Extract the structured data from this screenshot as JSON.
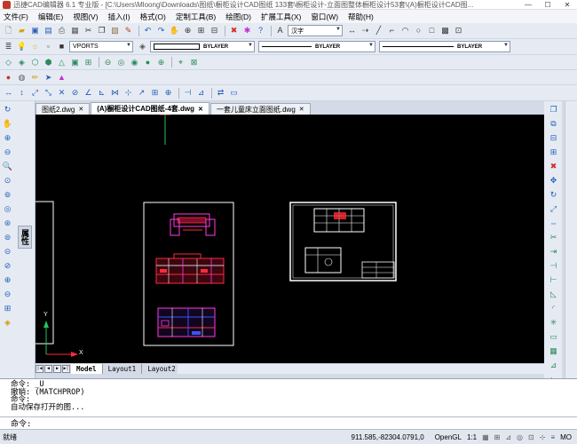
{
  "window": {
    "title": "迅捷CAD编辑器 6.1 专业版 - [C:\\Users\\Mloong\\Downloads\\图纸\\橱柜设计CAD图纸 133套\\橱柜设计-立面图整体橱柜设计53套\\(A)橱柜设计CAD图...",
    "minimize": "—",
    "maximize": "☐",
    "close": "✕"
  },
  "menu": [
    "文件(F)",
    "编辑(E)",
    "视图(V)",
    "插入(I)",
    "格式(O)",
    "定制工具(B)",
    "绘图(D)",
    "扩展工具(X)",
    "窗口(W)",
    "帮助(H)"
  ],
  "toolbars": {
    "font_combo": "汉字",
    "layer_combo": "VPORTS",
    "color_combo": "BYLAYER",
    "linetype_combo": "BYLAYER",
    "lineweight_combo": "BYLAYER"
  },
  "document_tabs": [
    {
      "label": "图纸2.dwg",
      "active": false
    },
    {
      "label": "(A)橱柜设计CAD图纸-4套.dwg",
      "active": true
    },
    {
      "label": "一套儿童床立面图纸.dwg",
      "active": false
    }
  ],
  "properties_panel": {
    "label": "属性"
  },
  "ucs": {
    "x_label": "X",
    "y_label": "Y"
  },
  "layout_tabs": [
    {
      "label": "Model",
      "active": true
    },
    {
      "label": "Layout1",
      "active": false
    },
    {
      "label": "Layout2",
      "active": false
    }
  ],
  "command_history": [
    "命令:  _U",
    "撤销: (MATCHPROP)",
    "命令:",
    "自动保存打开的图..."
  ],
  "command_prompt": "命令:",
  "status": {
    "left_text": "就绪",
    "coordinates": "911.585,-82304.0791,0",
    "mode_opengl": "OpenGL",
    "scale": "1:1",
    "model": "MO"
  },
  "colors": {
    "canvas_bg": "#000000",
    "frame_white": "#ffffff",
    "drawing_red": "#ff2a3a",
    "drawing_magenta": "#ff3de0",
    "drawing_blue": "#3b52ff",
    "ucs_green": "#22c55e"
  }
}
